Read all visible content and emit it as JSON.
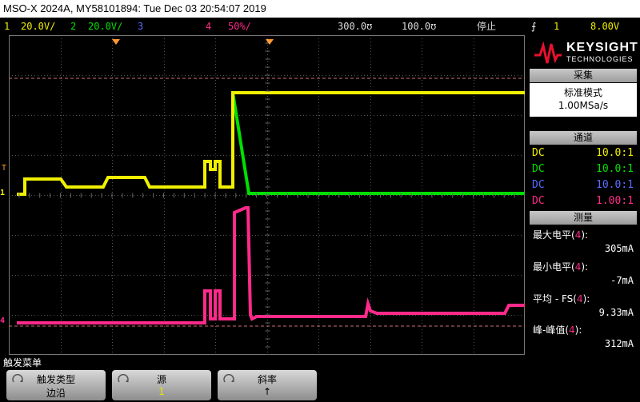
{
  "title": "MSO-X 2024A, MY58101894: Tue Dec 03 20:54:07 2019",
  "statusbar": {
    "ch1_num": "1",
    "ch1_scale": "20.0V/",
    "ch2_num": "2",
    "ch2_scale": "20.0V/",
    "ch3_num": "3",
    "ch4_num": "4",
    "ch4_scale": "50%/",
    "timebase": "300.0ʊ",
    "tpos": "100.0ʊ",
    "run_state": "停止",
    "trig_ch": "1",
    "trig_level": "8.00V"
  },
  "logo": {
    "brand": "KEYSIGHT",
    "sub": "TECHNOLOGIES"
  },
  "acquire": {
    "header": "采集",
    "mode": "标准模式",
    "rate": "1.00MSa/s"
  },
  "channels": {
    "header": "通道",
    "rows": [
      {
        "coupling": "DC",
        "ratio": "10.0:1",
        "color": "#f0f000"
      },
      {
        "coupling": "DC",
        "ratio": "10.0:1",
        "color": "#00e000"
      },
      {
        "coupling": "DC",
        "ratio": "10.0:1",
        "color": "#5a6cff"
      },
      {
        "coupling": "DC",
        "ratio": "1.00:1",
        "color": "#ff2a8a"
      }
    ]
  },
  "measure": {
    "header": "测量",
    "items": [
      {
        "label": "最大电平",
        "ch": "4",
        "value": "305mA"
      },
      {
        "label": "最小电平",
        "ch": "4",
        "value": "-7mA"
      },
      {
        "label": "平均 - FS",
        "ch": "4",
        "value": "9.33mA"
      },
      {
        "label": "峰-峰值",
        "ch": "4",
        "value": "312mA"
      }
    ]
  },
  "softkeys": {
    "menu_label": "触发菜单",
    "trigger_type": {
      "title": "触发类型",
      "value": "边沿"
    },
    "source": {
      "title": "源",
      "value": "1"
    },
    "slope": {
      "title": "斜率",
      "value": "↑"
    }
  },
  "markers": {
    "trig": "T",
    "ch1": "1",
    "ch4": "4"
  },
  "colors": {
    "ch1": "#f0f000",
    "ch2": "#00e000",
    "ch3": "#5a6cff",
    "ch4": "#ff2a8a",
    "marker": "#ff9933"
  }
}
